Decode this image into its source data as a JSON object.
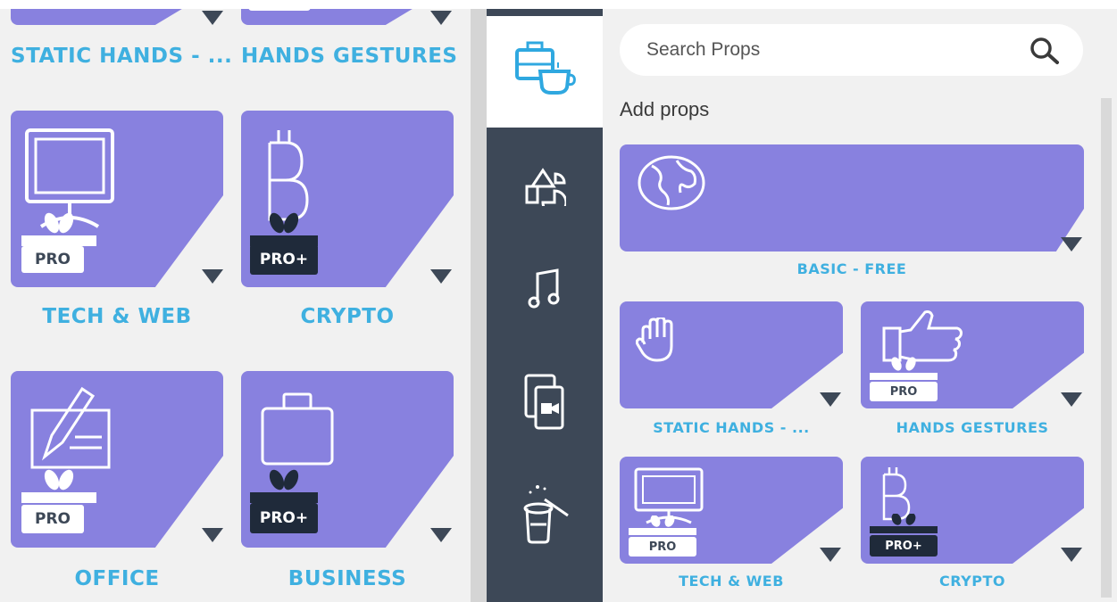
{
  "search": {
    "placeholder": "Search Props"
  },
  "section_title": "Add props",
  "badges": {
    "pro": "PRO",
    "pro_plus": "PRO+"
  },
  "left_labels": {
    "top_1": "STATIC HANDS - ...",
    "top_2": "HANDS GESTURES",
    "tech": "TECH & WEB",
    "crypto": "CRYPTO",
    "office": "OFFICE",
    "business": "BUSINESS"
  },
  "right_labels": {
    "basic": "BASIC - FREE",
    "static_hands": "STATIC HANDS - ...",
    "hands_gestures": "HANDS GESTURES",
    "tech": "TECH & WEB",
    "crypto": "CRYPTO"
  },
  "sidebar_icons": [
    "props-icon",
    "shapes-icon",
    "music-icon",
    "media-icon",
    "magic-hat-icon"
  ],
  "colors": {
    "card": "#8881df",
    "label": "#3fb0e0",
    "sidebar": "#3d4857",
    "accent_icon": "#2fa8e0"
  }
}
